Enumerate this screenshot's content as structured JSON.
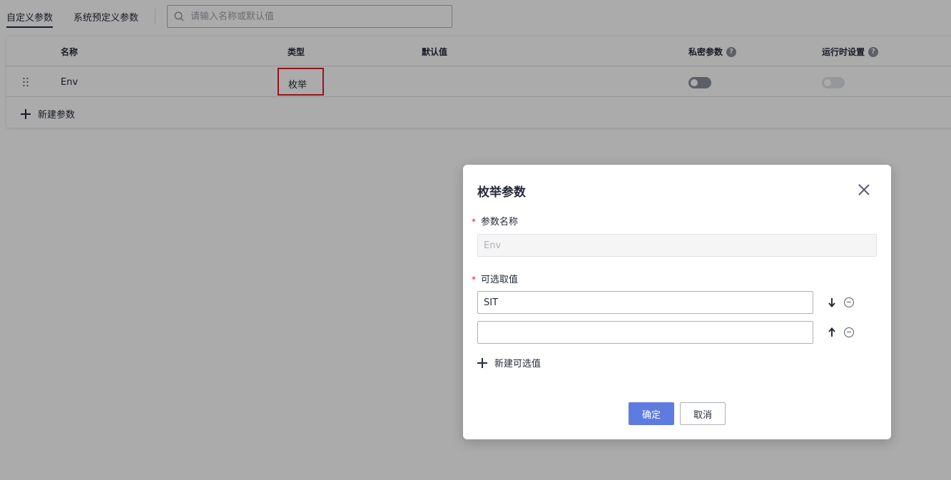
{
  "tabs": [
    {
      "label": "自定义参数",
      "active": true
    },
    {
      "label": "系统预定义参数",
      "active": false
    }
  ],
  "search": {
    "placeholder": "请输入名称或默认值",
    "value": ""
  },
  "table": {
    "headers": {
      "name": "名称",
      "type": "类型",
      "default": "默认值",
      "private": "私密参数",
      "runtime": "运行时设置"
    },
    "rows": [
      {
        "name": "Env",
        "type": "枚举",
        "default": "",
        "private": false,
        "runtime": false
      }
    ],
    "add_label": "新建参数"
  },
  "modal": {
    "title": "枚举参数",
    "name_label": "参数名称",
    "name_value": "Env",
    "options_label": "可选取值",
    "options": [
      {
        "value": "SIT",
        "move": "down"
      },
      {
        "value": "",
        "move": "up"
      }
    ],
    "add_option_label": "新建可选值",
    "confirm_label": "确定",
    "cancel_label": "取消"
  },
  "colors": {
    "primary": "#5e7ce0",
    "required": "#e21f26",
    "highlight": "#e21f26"
  }
}
